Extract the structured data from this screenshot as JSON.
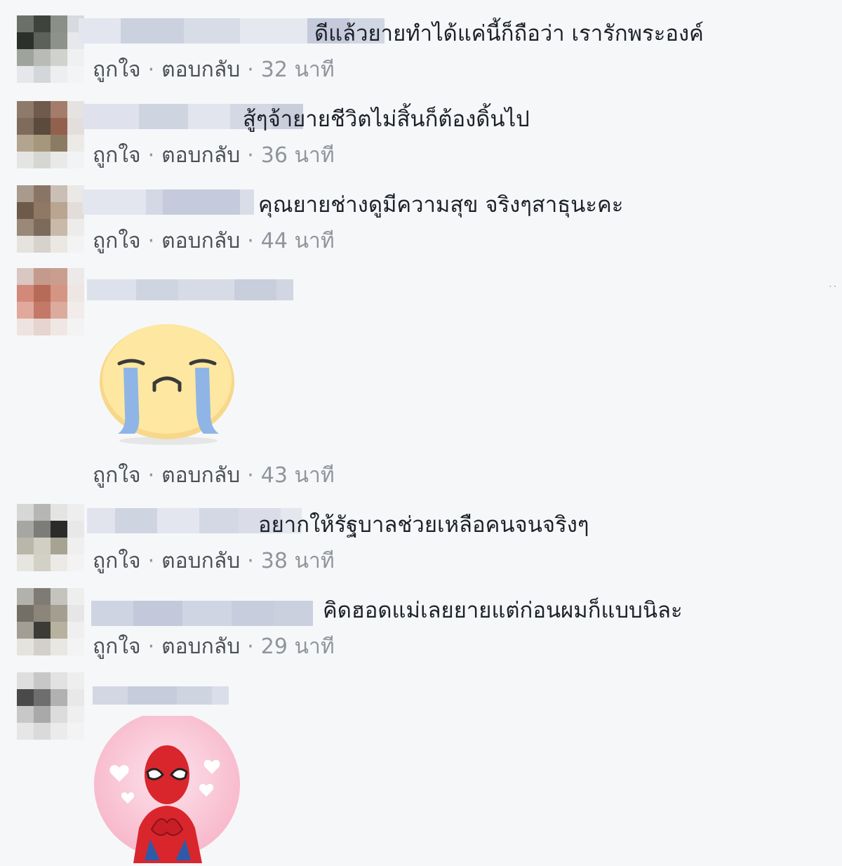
{
  "actions": {
    "like": "ถูกใจ",
    "reply": "ตอบกลับ",
    "sep": "·"
  },
  "comments": [
    {
      "text": "ดีแล้วยายทำได้แค่นี้ก็ถือว่า เรารักพระองค์",
      "time": "32 นาที"
    },
    {
      "text": "สู้ๆจ้ายายชีวิตไม่สิ้นก็ต้องดิ้นไป",
      "time": "36 นาที"
    },
    {
      "text": "คุณยายช่างดูมีความสุข จริงๆสาธุนะคะ",
      "time": "44 นาที"
    },
    {
      "text": "",
      "time": "43 นาที",
      "sticker": "crying-face-sticker"
    },
    {
      "text": "อยากให้รัฐบาลช่วยเหลือคนจนจริงๆ",
      "time": "38 นาที"
    },
    {
      "text": "คิดฮอดแม่เลยยายแต่ก่อนผมก็แบบนิละ",
      "time": "29 นาที"
    },
    {
      "text": "",
      "time": "",
      "sticker": "spiderman-heart-sticker"
    }
  ],
  "colors": {
    "background": "#f6f7f9",
    "text": "#1d2129",
    "meta": "#90949c",
    "name_blur": "#c9cfe0"
  },
  "more_icon": "ellipsis-icon"
}
